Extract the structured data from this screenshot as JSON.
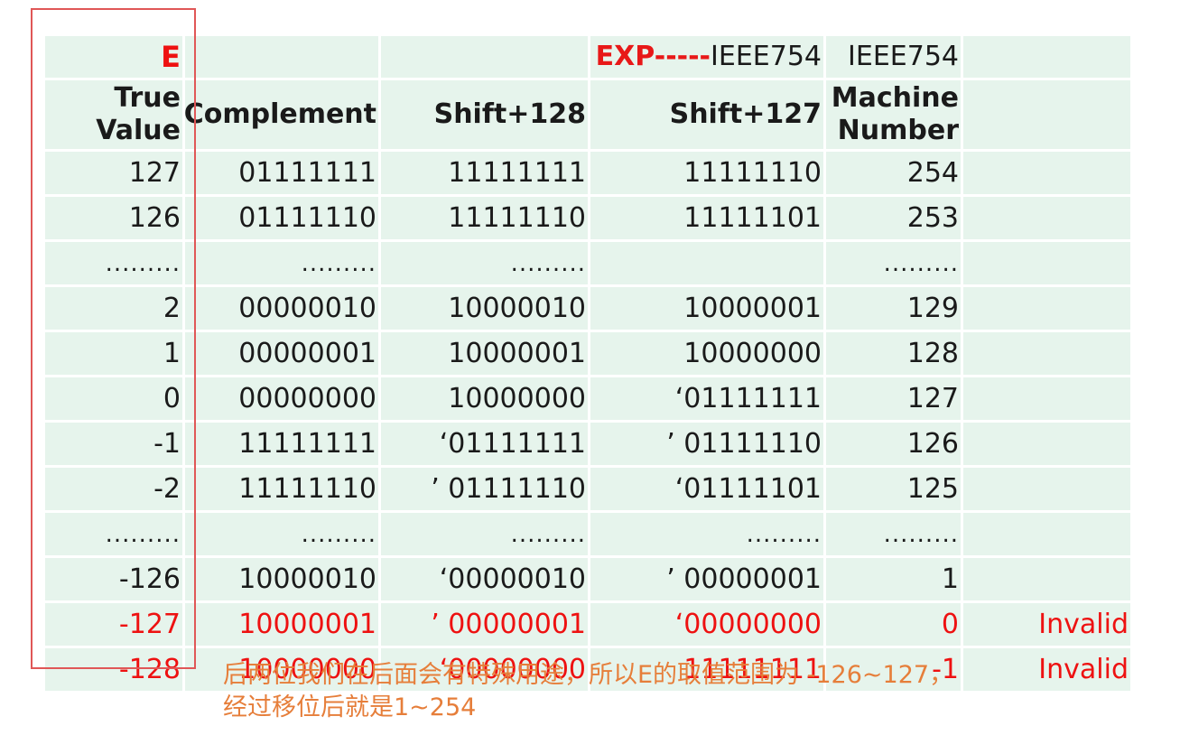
{
  "header": {
    "e_label": "E",
    "exp_label": "EXP-----",
    "ieee_a": "IEEE754",
    "ieee_b": "IEEE754",
    "true_value_1": "True",
    "true_value_2": "Value",
    "complement": "Complement",
    "shift128": "Shift+128",
    "shift127": "Shift+127",
    "machine_1": "Machine",
    "machine_2": "Number"
  },
  "rows": [
    {
      "tv": "127",
      "comp": "01111111",
      "s128": "11111111",
      "s127": "11111110",
      "mn": "254",
      "note": ""
    },
    {
      "tv": "126",
      "comp": "01111110",
      "s128": "11111110",
      "s127": "11111101",
      "mn": "253",
      "note": ""
    },
    {
      "tv": ".........",
      "comp": ".........",
      "s128": ".........",
      "s127": "",
      "mn": ".........",
      "note": ""
    },
    {
      "tv": "2",
      "comp": "00000010",
      "s128": "10000010",
      "s127": "10000001",
      "mn": "129",
      "note": ""
    },
    {
      "tv": "1",
      "comp": "00000001",
      "s128": "10000001",
      "s127": "10000000",
      "mn": "128",
      "note": ""
    },
    {
      "tv": "0",
      "comp": "00000000",
      "s128": "10000000",
      "s127": "‘01111111",
      "mn": "127",
      "note": ""
    },
    {
      "tv": "-1",
      "comp": "11111111",
      "s128": "‘01111111",
      "s127": "’ 01111110",
      "mn": "126",
      "note": ""
    },
    {
      "tv": "-2",
      "comp": "11111110",
      "s128": "’ 01111110",
      "s127": "‘01111101",
      "mn": "125",
      "note": ""
    },
    {
      "tv": ".........",
      "comp": ".........",
      "s128": ".........",
      "s127": ".........",
      "mn": ".........",
      "note": ""
    },
    {
      "tv": "-126",
      "comp": "10000010",
      "s128": "‘00000010",
      "s127": "’ 00000001",
      "mn": "1",
      "note": ""
    },
    {
      "tv": "-127",
      "comp": "10000001",
      "s128": "’ 00000001",
      "s127": "‘00000000",
      "mn": "0",
      "note": "Invalid"
    },
    {
      "tv": "-128",
      "comp": "10000000",
      "s128": "‘00000000",
      "s127": "11111111",
      "mn": "-1",
      "note": "Invalid"
    }
  ],
  "note": {
    "line1": "后两位我们在后面会有特殊用途，所以E的取值范围为 -126~127，",
    "line2": "经过移位后就是1~254"
  },
  "colors": {
    "cell_bg": "#e6f4ec",
    "invalid_text": "#ee1111",
    "highlight_border": "#e05757",
    "note_text": "#e67e3a"
  }
}
